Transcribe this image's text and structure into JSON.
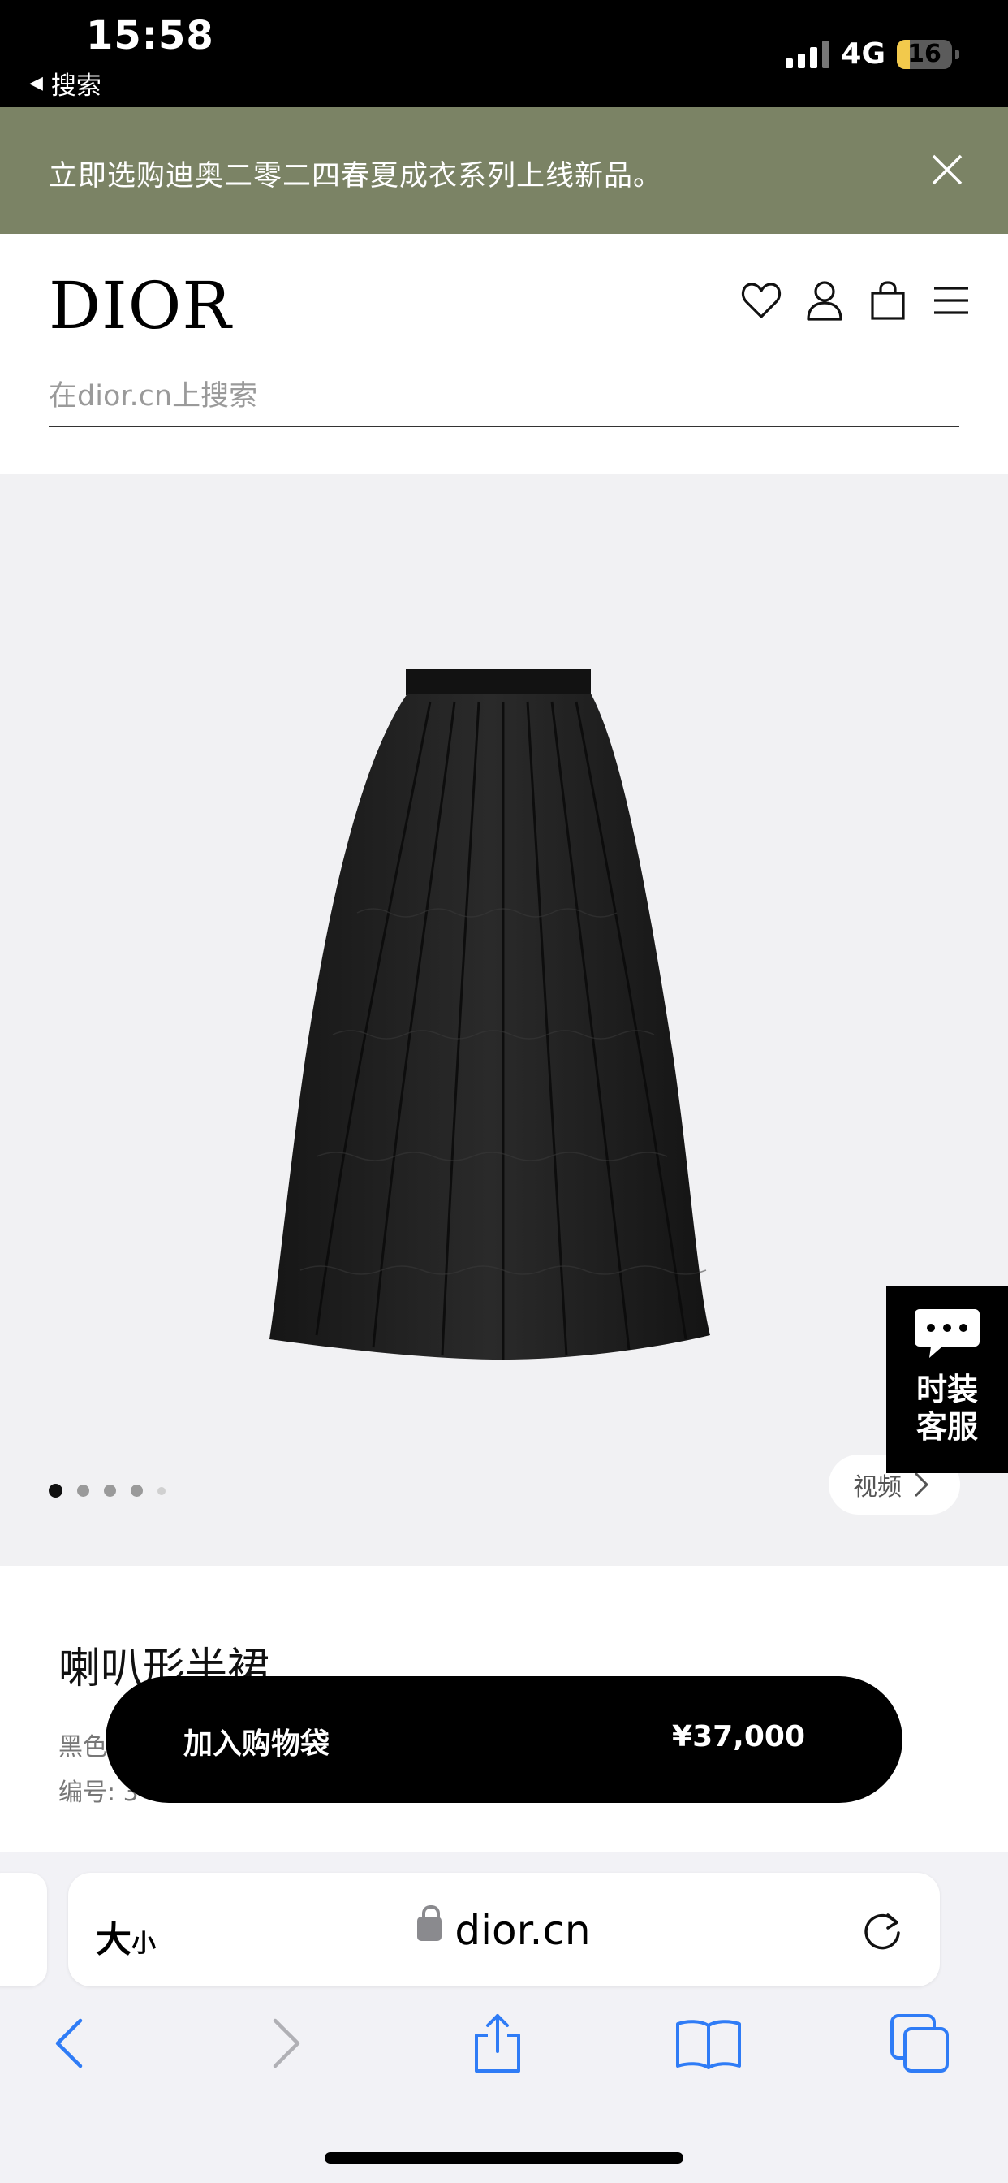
{
  "status_bar": {
    "time": "15:58",
    "back_label": "搜索",
    "network": "4G",
    "battery": "16"
  },
  "announcement": {
    "text": "立即选购迪奥二零二四春夏成衣系列上线新品。"
  },
  "header": {
    "logo": "DIOR",
    "search_placeholder": "在dior.cn上搜索"
  },
  "gallery": {
    "image_count": 5,
    "active_index": 0,
    "video_label": "视频"
  },
  "customer_service": {
    "label_line1": "时装",
    "label_line2": "客服"
  },
  "product": {
    "name": "喇叭形半裙",
    "color_partial": "黑色",
    "ref_partial": "编号: 3"
  },
  "add_to_bag": {
    "label": "加入购物袋",
    "price": "¥37,000"
  },
  "browser": {
    "text_size_big": "大",
    "text_size_small": "小",
    "domain": "dior.cn"
  },
  "colors": {
    "announcement_bg": "#7b8365",
    "hero_bg": "#f1f1f3",
    "ios_blue": "#2f7cf6"
  }
}
